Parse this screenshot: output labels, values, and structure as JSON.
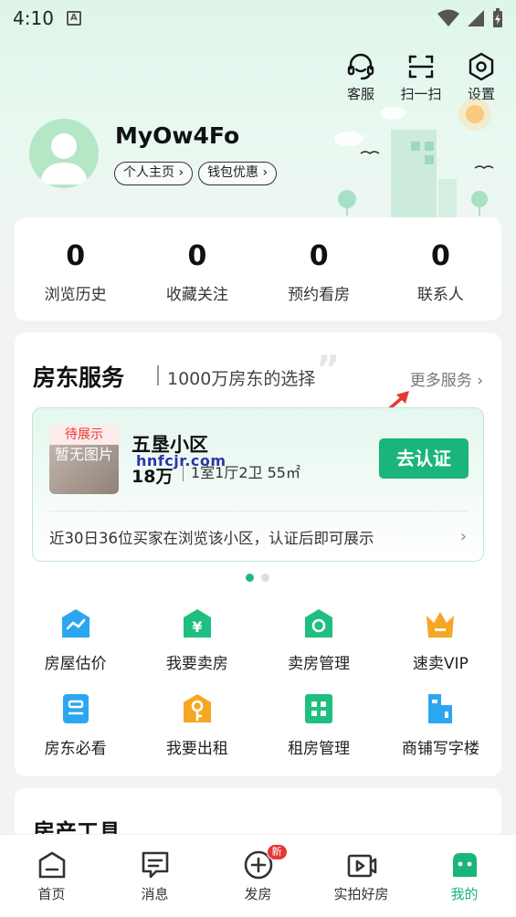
{
  "status_bar": {
    "time": "4:10",
    "notification_icon": "a-icon"
  },
  "top_tools": [
    {
      "label": "客服",
      "icon": "headset-icon"
    },
    {
      "label": "扫一扫",
      "icon": "scan-icon"
    },
    {
      "label": "设置",
      "icon": "settings-icon"
    }
  ],
  "user": {
    "name": "MyOw4Fo",
    "links": [
      "个人主页 ›",
      "钱包优惠 ›"
    ]
  },
  "stats": [
    {
      "value": "0",
      "label": "浏览历史"
    },
    {
      "value": "0",
      "label": "收藏关注"
    },
    {
      "value": "0",
      "label": "预约看房"
    },
    {
      "value": "0",
      "label": "联系人"
    }
  ],
  "services": {
    "title": "房东服务",
    "subtitle": "1000万房东的选择",
    "more": "更多服务 ›",
    "listing": {
      "badge": "待展示",
      "thumb_text": "暂无图片",
      "name": "五垦小区",
      "price": "18万",
      "spec": "1室1厅2卫 55㎡",
      "watermark": "hnfcjr.com",
      "button": "去认证",
      "note": "近30日36位买家在浏览该小区，认证后即可展示",
      "chevron": "›"
    },
    "carousel_pages": 2,
    "carousel_active": 1,
    "grid": [
      {
        "label": "房屋估价",
        "icon": "valuation-icon",
        "color": "#2aa7f0"
      },
      {
        "label": "我要卖房",
        "icon": "sell-house-icon",
        "color": "#1fbf7f"
      },
      {
        "label": "卖房管理",
        "icon": "sale-manage-icon",
        "color": "#1fbf7f"
      },
      {
        "label": "速卖VIP",
        "icon": "crown-icon",
        "color": "#f5a623"
      },
      {
        "label": "房东必看",
        "icon": "landlord-guide-icon",
        "color": "#2aa7f0"
      },
      {
        "label": "我要出租",
        "icon": "key-icon",
        "color": "#f5a623"
      },
      {
        "label": "租房管理",
        "icon": "rent-manage-icon",
        "color": "#1fbf7f"
      },
      {
        "label": "商铺写字楼",
        "icon": "office-building-icon",
        "color": "#2aa7f0"
      }
    ]
  },
  "tools_card": {
    "title": "房产工具"
  },
  "bottom_nav": [
    {
      "label": "首页",
      "icon": "home-icon",
      "active": false
    },
    {
      "label": "消息",
      "icon": "message-icon",
      "active": false
    },
    {
      "label": "发房",
      "icon": "post-house-icon",
      "active": false,
      "badge": "新"
    },
    {
      "label": "实拍好房",
      "icon": "video-icon",
      "active": false
    },
    {
      "label": "我的",
      "icon": "profile-icon",
      "active": true
    }
  ],
  "colors": {
    "accent": "#1ab57b",
    "badge_red": "#e53935"
  }
}
